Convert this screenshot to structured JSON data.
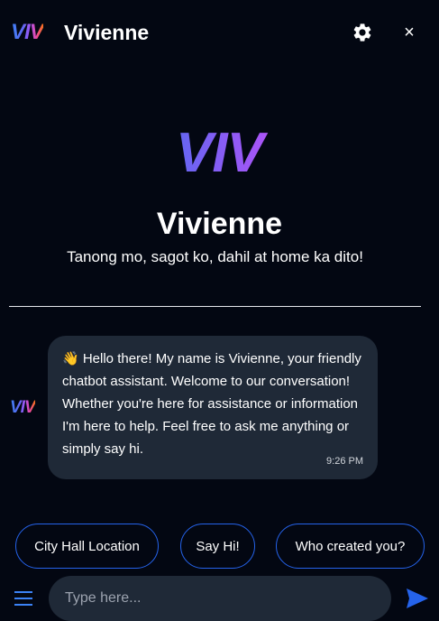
{
  "header": {
    "logo_text": "VIV",
    "title": "Vivienne",
    "settings_icon": "gear-icon",
    "close_icon": "close-icon",
    "close_glyph": "×"
  },
  "hero": {
    "logo_text": "VIV",
    "name": "Vivienne",
    "tagline": "Tanong mo, sagot ko, dahil at home ka dito!"
  },
  "message": {
    "avatar_text": "VIV",
    "text": "👋 Hello there! My name is Vivienne, your friendly chatbot assistant. Welcome to our conversation! Whether you're here for assistance or information I'm here to help. Feel free to ask me anything or simply say hi.",
    "time": "9:26 PM"
  },
  "quick_replies": [
    {
      "label": "City Hall Location"
    },
    {
      "label": "Say Hi!"
    },
    {
      "label": "Who created you?"
    }
  ],
  "composer": {
    "placeholder": "Type here...",
    "menu_icon": "hamburger-menu-icon",
    "send_icon": "send-icon"
  },
  "colors": {
    "background": "#030712",
    "bubble": "#1f2937",
    "accent": "#2563eb"
  }
}
